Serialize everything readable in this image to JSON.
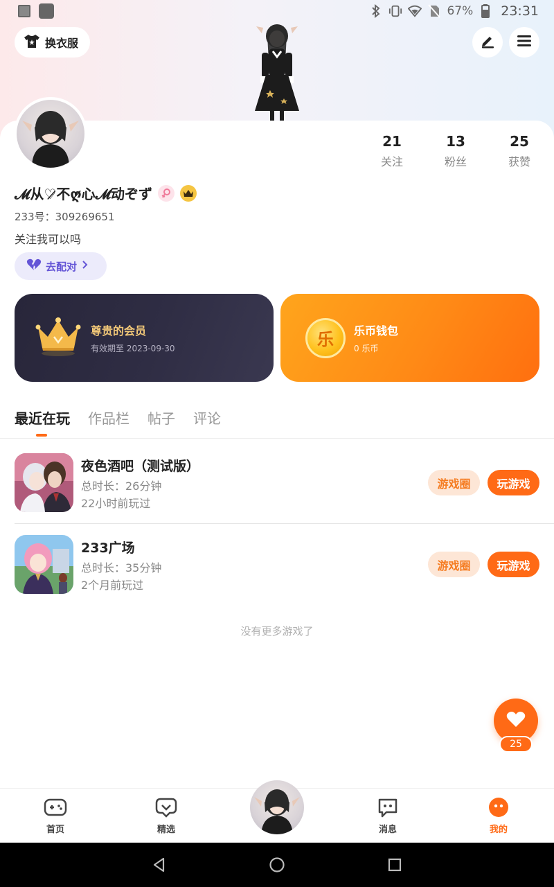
{
  "status_bar": {
    "battery": "67%",
    "time": "23:31"
  },
  "header": {
    "outfit_label": "换衣服"
  },
  "profile": {
    "nickname": "𝓜从♡̷不ღ̷心𝓜动ぞず",
    "uid": "233号：309269651",
    "bio": "关注我可以吗",
    "pair_label": "去配对",
    "stats": [
      {
        "value": "21",
        "label": "关注"
      },
      {
        "value": "13",
        "label": "粉丝"
      },
      {
        "value": "25",
        "label": "获赞"
      }
    ]
  },
  "cards": {
    "vip": {
      "title": "尊贵的会员",
      "subtitle": "有效期至 2023-09-30"
    },
    "wallet": {
      "coin_glyph": "乐",
      "title": "乐币钱包",
      "subtitle": "0 乐币"
    }
  },
  "tabs": [
    "最近在玩",
    "作品栏",
    "帖子",
    "评论"
  ],
  "games": [
    {
      "name": "夜色酒吧（测试版）",
      "duration": "总时长：26分钟",
      "last_played": "22小时前玩过",
      "circle_label": "游戏圈",
      "play_label": "玩游戏"
    },
    {
      "name": "233广场",
      "duration": "总时长：35分钟",
      "last_played": "2个月前玩过",
      "circle_label": "游戏圈",
      "play_label": "玩游戏"
    }
  ],
  "no_more_text": "没有更多游戏了",
  "like_count": "25",
  "bottom_nav": [
    {
      "label": "首页",
      "icon": "gamepad-icon"
    },
    {
      "label": "精选",
      "icon": "heart-chat-icon"
    },
    {
      "label": "消息",
      "icon": "message-icon"
    },
    {
      "label": "我的",
      "icon": "me-face-icon"
    }
  ],
  "colors": {
    "accent": "#ff6a16",
    "vip_gold": "#f2c878",
    "pair_purple": "#6455d6"
  }
}
